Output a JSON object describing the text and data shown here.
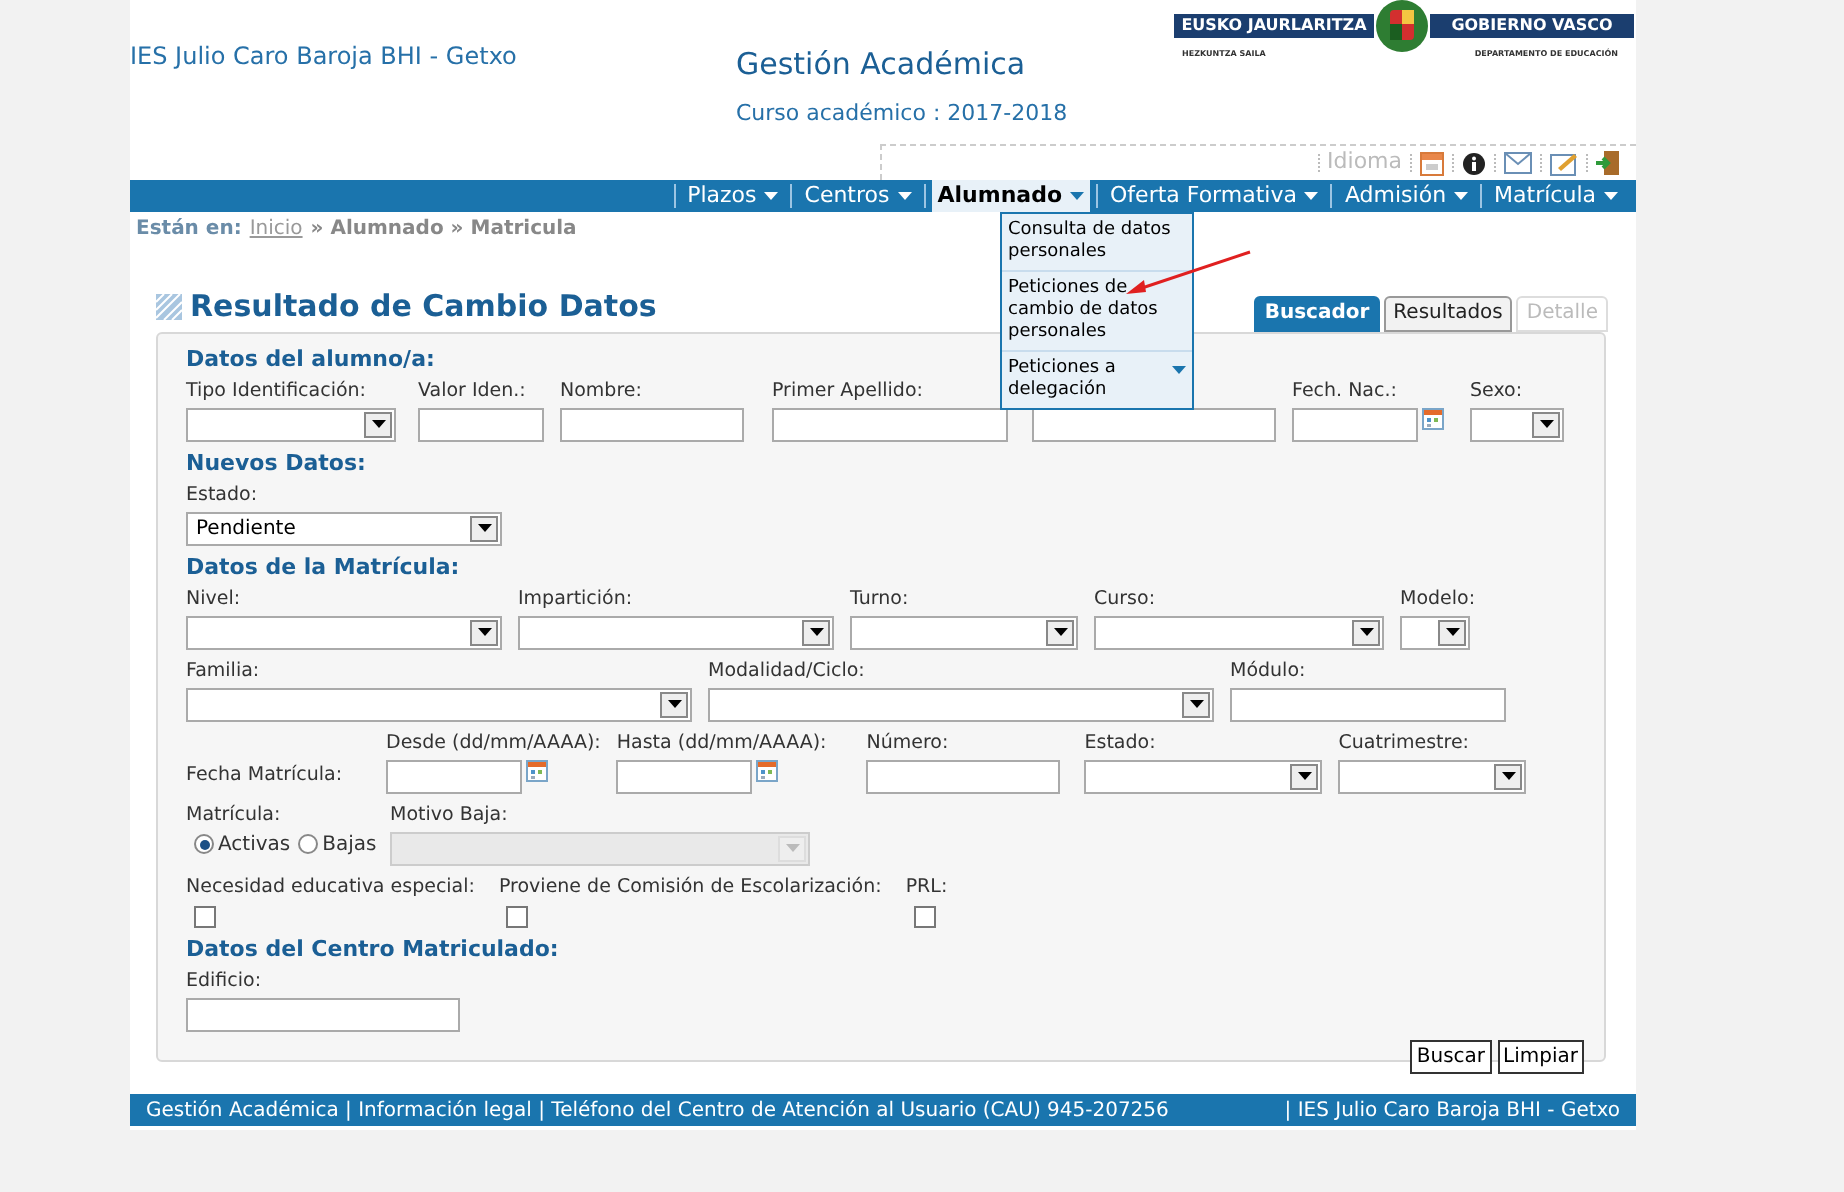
{
  "header": {
    "school": "IES Julio Caro Baroja BHI - Getxo",
    "app_title": "Gestión Académica",
    "course": "Curso académico : 2017-2018",
    "logo": {
      "left": "EUSKO JAURLARITZA",
      "right": "GOBIERNO VASCO",
      "left_sub": "HEZKUNTZA SAILA",
      "right_sub": "DEPARTAMENTO DE EDUCACIÓN"
    }
  },
  "toolbar": {
    "language": "Idioma"
  },
  "nav": [
    {
      "label": "Plazos",
      "selected": false
    },
    {
      "label": "Centros",
      "selected": false
    },
    {
      "label": "Alumnado",
      "selected": true
    },
    {
      "label": "Oferta Formativa",
      "selected": false
    },
    {
      "label": "Admisión",
      "selected": false
    },
    {
      "label": "Matrícula",
      "selected": false
    }
  ],
  "menu": {
    "items": [
      "Consulta de datos personales",
      "Peticiones de cambio de datos personales",
      "Peticiones a delegación"
    ]
  },
  "breadcrumb": {
    "prefix": "Están en:",
    "link": "Inicio",
    "rest": "» Alumnado » Matricula"
  },
  "page_title": "Resultado de Cambio Datos",
  "tabs": [
    {
      "label": "Buscador",
      "selected": true,
      "disabled": false
    },
    {
      "label": "Resultados",
      "selected": false,
      "disabled": false
    },
    {
      "label": "Detalle",
      "selected": false,
      "disabled": true
    }
  ],
  "sections": [
    {
      "title": "Datos del alumno/a:",
      "rows": [
        {
          "fields": [
            {
              "kind": "select",
              "label": "Tipo Identificación:"
            },
            {
              "kind": "text",
              "label": "Valor Iden.:"
            },
            {
              "kind": "text",
              "label": "Nombre:"
            },
            {
              "kind": "text",
              "label": "Primer Apellido:"
            },
            {
              "kind": "text"
            },
            {
              "kind": "date",
              "label": "Fech. Nac.:"
            },
            {
              "kind": "select",
              "label": "Sexo:"
            }
          ]
        }
      ]
    },
    {
      "title": "Nuevos Datos:",
      "rows": [
        {
          "fields": [
            {
              "kind": "select",
              "label": "Estado:",
              "value": "Pendiente"
            }
          ]
        }
      ]
    },
    {
      "title": "Datos de la Matrícula:",
      "rows": [
        {
          "fields": [
            {
              "kind": "select",
              "label": "Nivel:"
            },
            {
              "kind": "select",
              "label": "Impartición:"
            },
            {
              "kind": "select",
              "label": "Turno:"
            },
            {
              "kind": "select",
              "label": "Curso:"
            },
            {
              "kind": "select",
              "label": "Modelo:"
            }
          ]
        },
        {
          "fields": [
            {
              "kind": "select",
              "label": "Familia:"
            },
            {
              "kind": "select",
              "label": "Modalidad/Ciclo:"
            },
            {
              "kind": "text",
              "label": "Módulo:"
            }
          ]
        },
        {
          "fields": [
            {
              "kind": "inline",
              "label": "Fecha Matrícula:"
            },
            {
              "kind": "date",
              "label": "Desde (dd/mm/AAAA):"
            },
            {
              "kind": "date",
              "label": "Hasta (dd/mm/AAAA):"
            },
            {
              "kind": "text",
              "label": "Número:"
            },
            {
              "kind": "select",
              "label": "Estado:"
            },
            {
              "kind": "select",
              "label": "Cuatrimestre:"
            }
          ]
        },
        {
          "fields": [
            {
              "kind": "radio",
              "label": "Matrícula:",
              "options": [
                {
                  "label": "Activas",
                  "selected": true
                },
                {
                  "label": "Bajas",
                  "selected": false
                }
              ]
            },
            {
              "kind": "select",
              "label": "Motivo Baja:",
              "disabled": true
            }
          ]
        },
        {
          "fields": [
            {
              "kind": "checkbox",
              "label": "Necesidad educativa especial:",
              "checked": false
            },
            {
              "kind": "checkbox",
              "label": "Proviene de Comisión de Escolarización:",
              "checked": false
            },
            {
              "kind": "checkbox",
              "label": "PRL:",
              "checked": false
            }
          ]
        }
      ]
    },
    {
      "title": "Datos del Centro Matriculado:",
      "rows": [
        {
          "fields": [
            {
              "kind": "text",
              "label": "Edificio:"
            }
          ]
        }
      ]
    }
  ],
  "buttons": [
    "Buscar",
    "Limpiar"
  ],
  "footer": {
    "left": "Gestión Académica | Información legal | Teléfono del Centro de Atención al Usuario (CAU) 945-207256",
    "right": "| IES Julio Caro Baroja BHI - Getxo"
  }
}
